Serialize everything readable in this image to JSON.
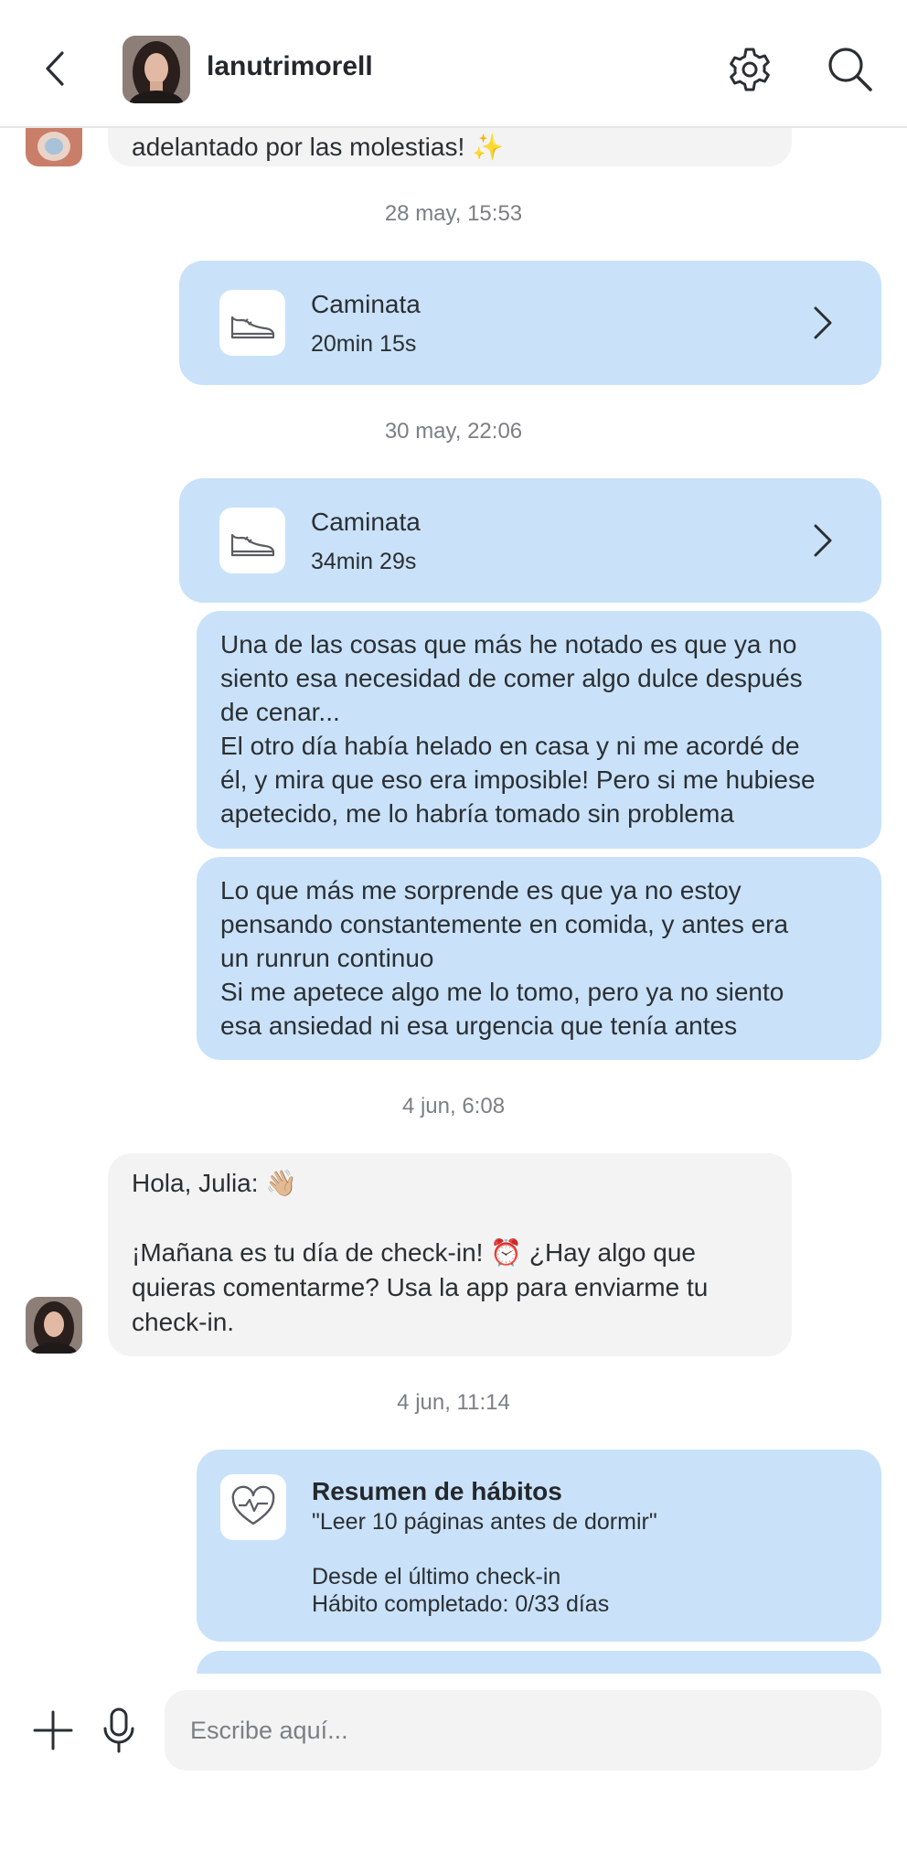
{
  "header": {
    "username": "lanutrimorell",
    "icons": {
      "back": "chevron-left-icon",
      "settings": "gear-icon",
      "search": "search-icon"
    }
  },
  "messages": {
    "partial_in_text": "adelantado por las molestias! ✨",
    "ts1": "28 may, 15:53",
    "walk1": {
      "title": "Caminata",
      "duration": "20min 15s"
    },
    "ts2": "30 may, 22:06",
    "walk2": {
      "title": "Caminata",
      "duration": "34min 29s"
    },
    "out1_lines": [
      "Una de las cosas que más he notado es que ya no",
      "siento esa necesidad de comer algo dulce después",
      "de cenar...",
      "El otro día había helado en casa y ni me acordé de",
      "él, y mira que eso era imposible! Pero si me hubiese",
      "apetecido, me lo habría tomado sin problema"
    ],
    "out2_lines": [
      "Lo que más me sorprende es que ya no estoy",
      "pensando constantemente en comida, y antes era",
      "un runrun continuo",
      "Si me apetece algo me lo tomo, pero ya no siento",
      "esa ansiedad ni esa urgencia que tenía antes"
    ],
    "ts3": "4 jun, 6:08",
    "in2": {
      "greeting": "Hola, Julia: 👋🏼",
      "line1": "¡Mañana es tu día de check-in! ⏰ ¿Hay algo que",
      "line2": "quieras comentarme? Usa la app para enviarme tu",
      "line3": "check-in."
    },
    "ts4": "4 jun, 11:14",
    "habits": {
      "title": "Resumen de hábitos",
      "habit": "\"Leer 10 páginas antes de dormir\"",
      "since": "Desde el último check-in",
      "completed": "Hábito completado: 0/33 días"
    }
  },
  "composer": {
    "placeholder": "Escribe aquí...",
    "icons": {
      "add": "plus-icon",
      "voice": "microphone-icon"
    }
  },
  "colors": {
    "outgoing_bubble": "#c9e2f9",
    "incoming_bubble": "#f3f3f3",
    "timestamp": "#7b7f84"
  }
}
